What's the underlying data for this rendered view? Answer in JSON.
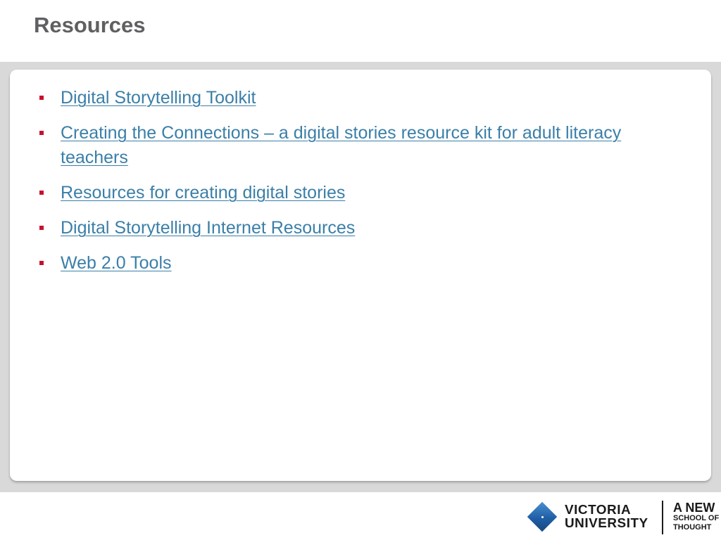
{
  "slide": {
    "title": "Resources"
  },
  "content": {
    "bullet_color": "#c8102e",
    "link_color": "#3b7fa8",
    "links": [
      {
        "label": "Digital Storytelling Toolkit"
      },
      {
        "label": "Creating the Connections – a digital stories resource kit for adult literacy teachers"
      },
      {
        "label": "Resources for creating digital stories"
      },
      {
        "label": "Digital Storytelling Internet Resources"
      },
      {
        "label": "Web 2.0 Tools"
      }
    ]
  },
  "footer": {
    "logo": {
      "icon": "diamond-icon",
      "name_line1": "VICTORIA",
      "name_line2": "UNIVERSITY",
      "tagline_line1": "A NEW",
      "tagline_line2": "SCHOOL OF",
      "tagline_line3": "THOUGHT",
      "brand_color": "#1f5fa6"
    }
  }
}
